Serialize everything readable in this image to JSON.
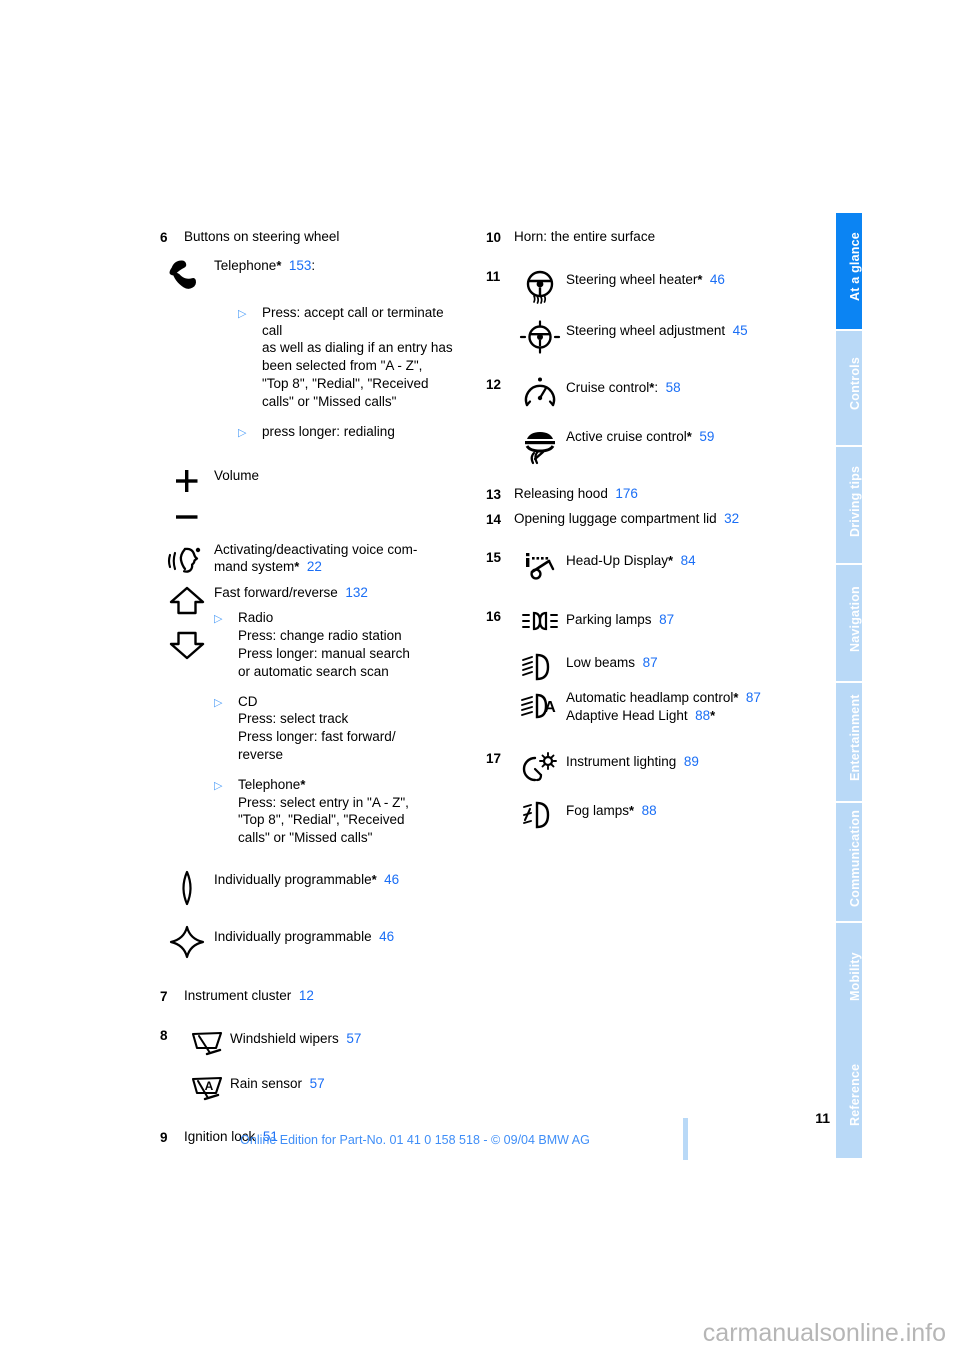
{
  "document": {
    "page_number": "11",
    "footer_note": "Online Edition for Part-No. 01 41 0 158 518 - © 09/04 BMW AG",
    "watermark": "carmanualsonline.info"
  },
  "colors": {
    "accent_blue": "#1a6ef5",
    "tab_active": "#0b84f3",
    "tab_inactive": "#b9d9f7",
    "bullet_blue": "#4f9ef7",
    "footer_blue": "#3f8ef7"
  },
  "tabs": [
    {
      "label": "At a glance",
      "active": true
    },
    {
      "label": "Controls",
      "active": false
    },
    {
      "label": "Driving tips",
      "active": false
    },
    {
      "label": "Navigation",
      "active": false
    },
    {
      "label": "Entertainment",
      "active": false
    },
    {
      "label": "Communication",
      "active": false
    },
    {
      "label": "Mobility",
      "active": false
    },
    {
      "label": "Reference",
      "active": false
    }
  ],
  "left_column": {
    "item6": {
      "num": "6",
      "title": "Buttons on steering wheel",
      "telephone_label": "Telephone",
      "telephone_asterisk": "*",
      "telephone_page": "153",
      "telephone_colon": ":",
      "bullet1_lines": [
        "Press: accept call or terminate",
        "call",
        "as well as dialing if an entry has",
        "been selected from \"A - Z\",",
        "\"Top 8\", \"Redial\", \"Received",
        "calls\" or \"Missed calls\""
      ],
      "bullet2": "press longer: redialing",
      "volume_label": "Volume",
      "voice_line1": "Activating/deactivating voice com-",
      "voice_line2": "mand system",
      "voice_asterisk": "*",
      "voice_page": "22",
      "ff_label": "Fast forward/reverse",
      "ff_page": "132",
      "radio_heading": "Radio",
      "radio_lines": [
        "Press: change radio station",
        "Press longer: manual search",
        "or automatic search scan"
      ],
      "cd_heading": "CD",
      "cd_lines": [
        "Press: select track",
        "Press longer: fast forward/",
        "reverse"
      ],
      "tel2_heading": "Telephone",
      "tel2_asterisk": "*",
      "tel2_lines": [
        "Press: select entry in \"A - Z\",",
        "\"Top 8\", \"Redial\", \"Received",
        "calls\" or \"Missed calls\""
      ],
      "prog_star_label": "Individually programmable",
      "prog_star_asterisk": "*",
      "prog_star_page": "46",
      "prog_label": "Individually programmable",
      "prog_page": "46"
    },
    "item7": {
      "num": "7",
      "title": "Instrument cluster",
      "page": "12"
    },
    "item8": {
      "num": "8",
      "wipers_label": "Windshield wipers",
      "wipers_page": "57",
      "rain_label": "Rain sensor",
      "rain_page": "57",
      "rain_icon_letter": "A"
    },
    "item9": {
      "num": "9",
      "title": "Ignition lock",
      "page": "51"
    }
  },
  "right_column": {
    "item10": {
      "num": "10",
      "title": "Horn: the entire surface"
    },
    "item11": {
      "num": "11",
      "heater_label": "Steering wheel heater",
      "heater_asterisk": "*",
      "heater_page": "46",
      "adjust_label": "Steering wheel adjustment",
      "adjust_page": "45"
    },
    "item12": {
      "num": "12",
      "cruise_label": "Cruise control",
      "cruise_asterisk": "*",
      "cruise_colon": ":",
      "cruise_page": "58",
      "acc_label": "Active cruise control",
      "acc_asterisk": "*",
      "acc_page": "59"
    },
    "item13": {
      "num": "13",
      "title": "Releasing hood",
      "page": "176"
    },
    "item14": {
      "num": "14",
      "title": "Opening luggage compartment lid",
      "page": "32"
    },
    "item15": {
      "num": "15",
      "hud_label": "Head-Up Display",
      "hud_asterisk": "*",
      "hud_page": "84"
    },
    "item16": {
      "num": "16",
      "parking_label": "Parking lamps",
      "parking_page": "87",
      "low_label": "Low beams",
      "low_page": "87",
      "auto_label": "Automatic headlamp control",
      "auto_asterisk": "*",
      "auto_page": "87",
      "adaptive_label": "Adaptive Head Light",
      "adaptive_page": "88",
      "adaptive_asterisk": "*",
      "auto_icon_letter": "A"
    },
    "item17": {
      "num": "17",
      "instrument_label": "Instrument lighting",
      "instrument_page": "89",
      "fog_label": "Fog lamps",
      "fog_asterisk": "*",
      "fog_page": "88"
    }
  }
}
